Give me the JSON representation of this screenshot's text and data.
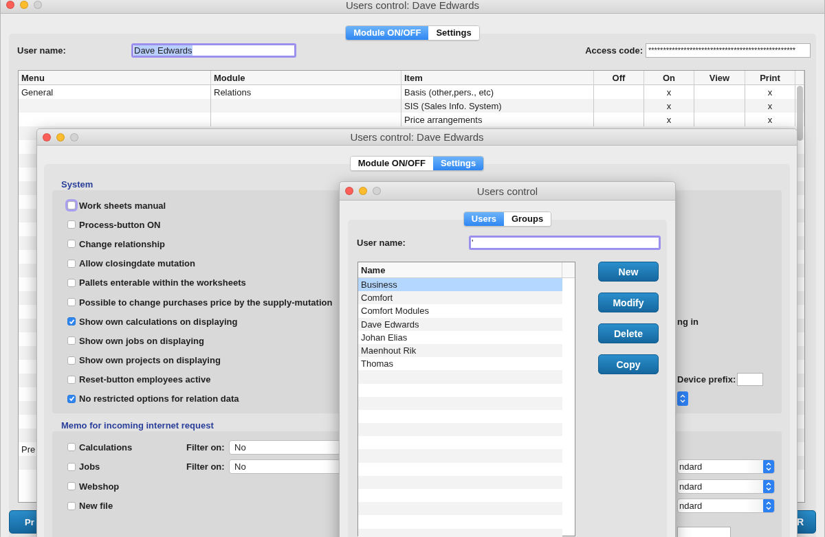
{
  "main_window": {
    "title": "Users control: Dave Edwards",
    "tabs": [
      {
        "label": "Module ON/OFF",
        "selected": true
      },
      {
        "label": "Settings",
        "selected": false
      }
    ],
    "user_name": {
      "label": "User name:",
      "value": "Dave Edwards",
      "focused": true,
      "text_selected": true
    },
    "access_code": {
      "label": "Access code:",
      "value": "**************************************************"
    },
    "table": {
      "columns": [
        "Menu",
        "Module",
        "Item",
        "Off",
        "On",
        "View",
        "Print"
      ],
      "rows": [
        [
          "General",
          "Relations",
          "Basis (other,pers., etc)",
          "",
          "x",
          "",
          "x"
        ],
        [
          "",
          "",
          "SIS (Sales Info. System)",
          "",
          "x",
          "",
          "x"
        ],
        [
          "",
          "",
          "Price arrangements",
          "",
          "x",
          "",
          "x"
        ]
      ],
      "partial_row_menu": "Pre"
    },
    "footer_buttons": [
      "Pr",
      "R"
    ]
  },
  "settings_window": {
    "title": "Users control: Dave Edwards",
    "tabs": [
      {
        "label": "Module ON/OFF",
        "selected": false
      },
      {
        "label": "Settings",
        "selected": true
      }
    ],
    "system": {
      "title": "System",
      "items": [
        {
          "label": "Work sheets manual",
          "checked": false,
          "focused": true
        },
        {
          "label": "Process-button ON",
          "checked": false,
          "focused": false
        },
        {
          "label": "Change relationship",
          "checked": false,
          "focused": false
        },
        {
          "label": "Allow closingdate mutation",
          "checked": false,
          "focused": false
        },
        {
          "label": "Pallets enterable within the worksheets",
          "checked": false,
          "focused": false
        },
        {
          "label": "Possible to change purchases price by the supply-mutation",
          "checked": false,
          "focused": false
        },
        {
          "label": "Show own calculations on displaying",
          "checked": true,
          "focused": false
        },
        {
          "label": "Show own jobs on displaying",
          "checked": false,
          "focused": false
        },
        {
          "label": "Show own projects on displaying",
          "checked": false,
          "focused": false
        },
        {
          "label": "Reset-button employees active",
          "checked": false,
          "focused": false
        },
        {
          "label": "No restricted options for relation data",
          "checked": true,
          "focused": false
        }
      ],
      "side_text": "ng in",
      "device_prefix_label": "Device prefix:"
    },
    "memo": {
      "title": "Memo for incoming internet request",
      "items": [
        {
          "label": "Calculations",
          "checked": false,
          "filter_label": "Filter on:",
          "filter_value": "No"
        },
        {
          "label": "Jobs",
          "checked": false,
          "filter_label": "Filter on:",
          "filter_value": "No"
        },
        {
          "label": "Webshop",
          "checked": false
        },
        {
          "label": "New file",
          "checked": false
        }
      ],
      "side_dropdowns": [
        "ndard",
        "ndard",
        "ndard"
      ]
    }
  },
  "users_dialog": {
    "title": "Users control",
    "tabs": [
      {
        "label": "Users",
        "selected": true
      },
      {
        "label": "Groups",
        "selected": false
      }
    ],
    "user_name": {
      "label": "User name:",
      "value": "'",
      "focused": true
    },
    "list": {
      "header": "Name",
      "items": [
        {
          "label": "Business",
          "selected": true
        },
        {
          "label": "Comfort",
          "selected": false
        },
        {
          "label": "Comfort Modules",
          "selected": false
        },
        {
          "label": "Dave Edwards",
          "selected": false
        },
        {
          "label": "Johan Elias",
          "selected": false
        },
        {
          "label": "Maenhout Rik",
          "selected": false
        },
        {
          "label": "Thomas",
          "selected": false
        }
      ]
    },
    "buttons": [
      "New",
      "Modify",
      "Delete",
      "Copy"
    ]
  }
}
